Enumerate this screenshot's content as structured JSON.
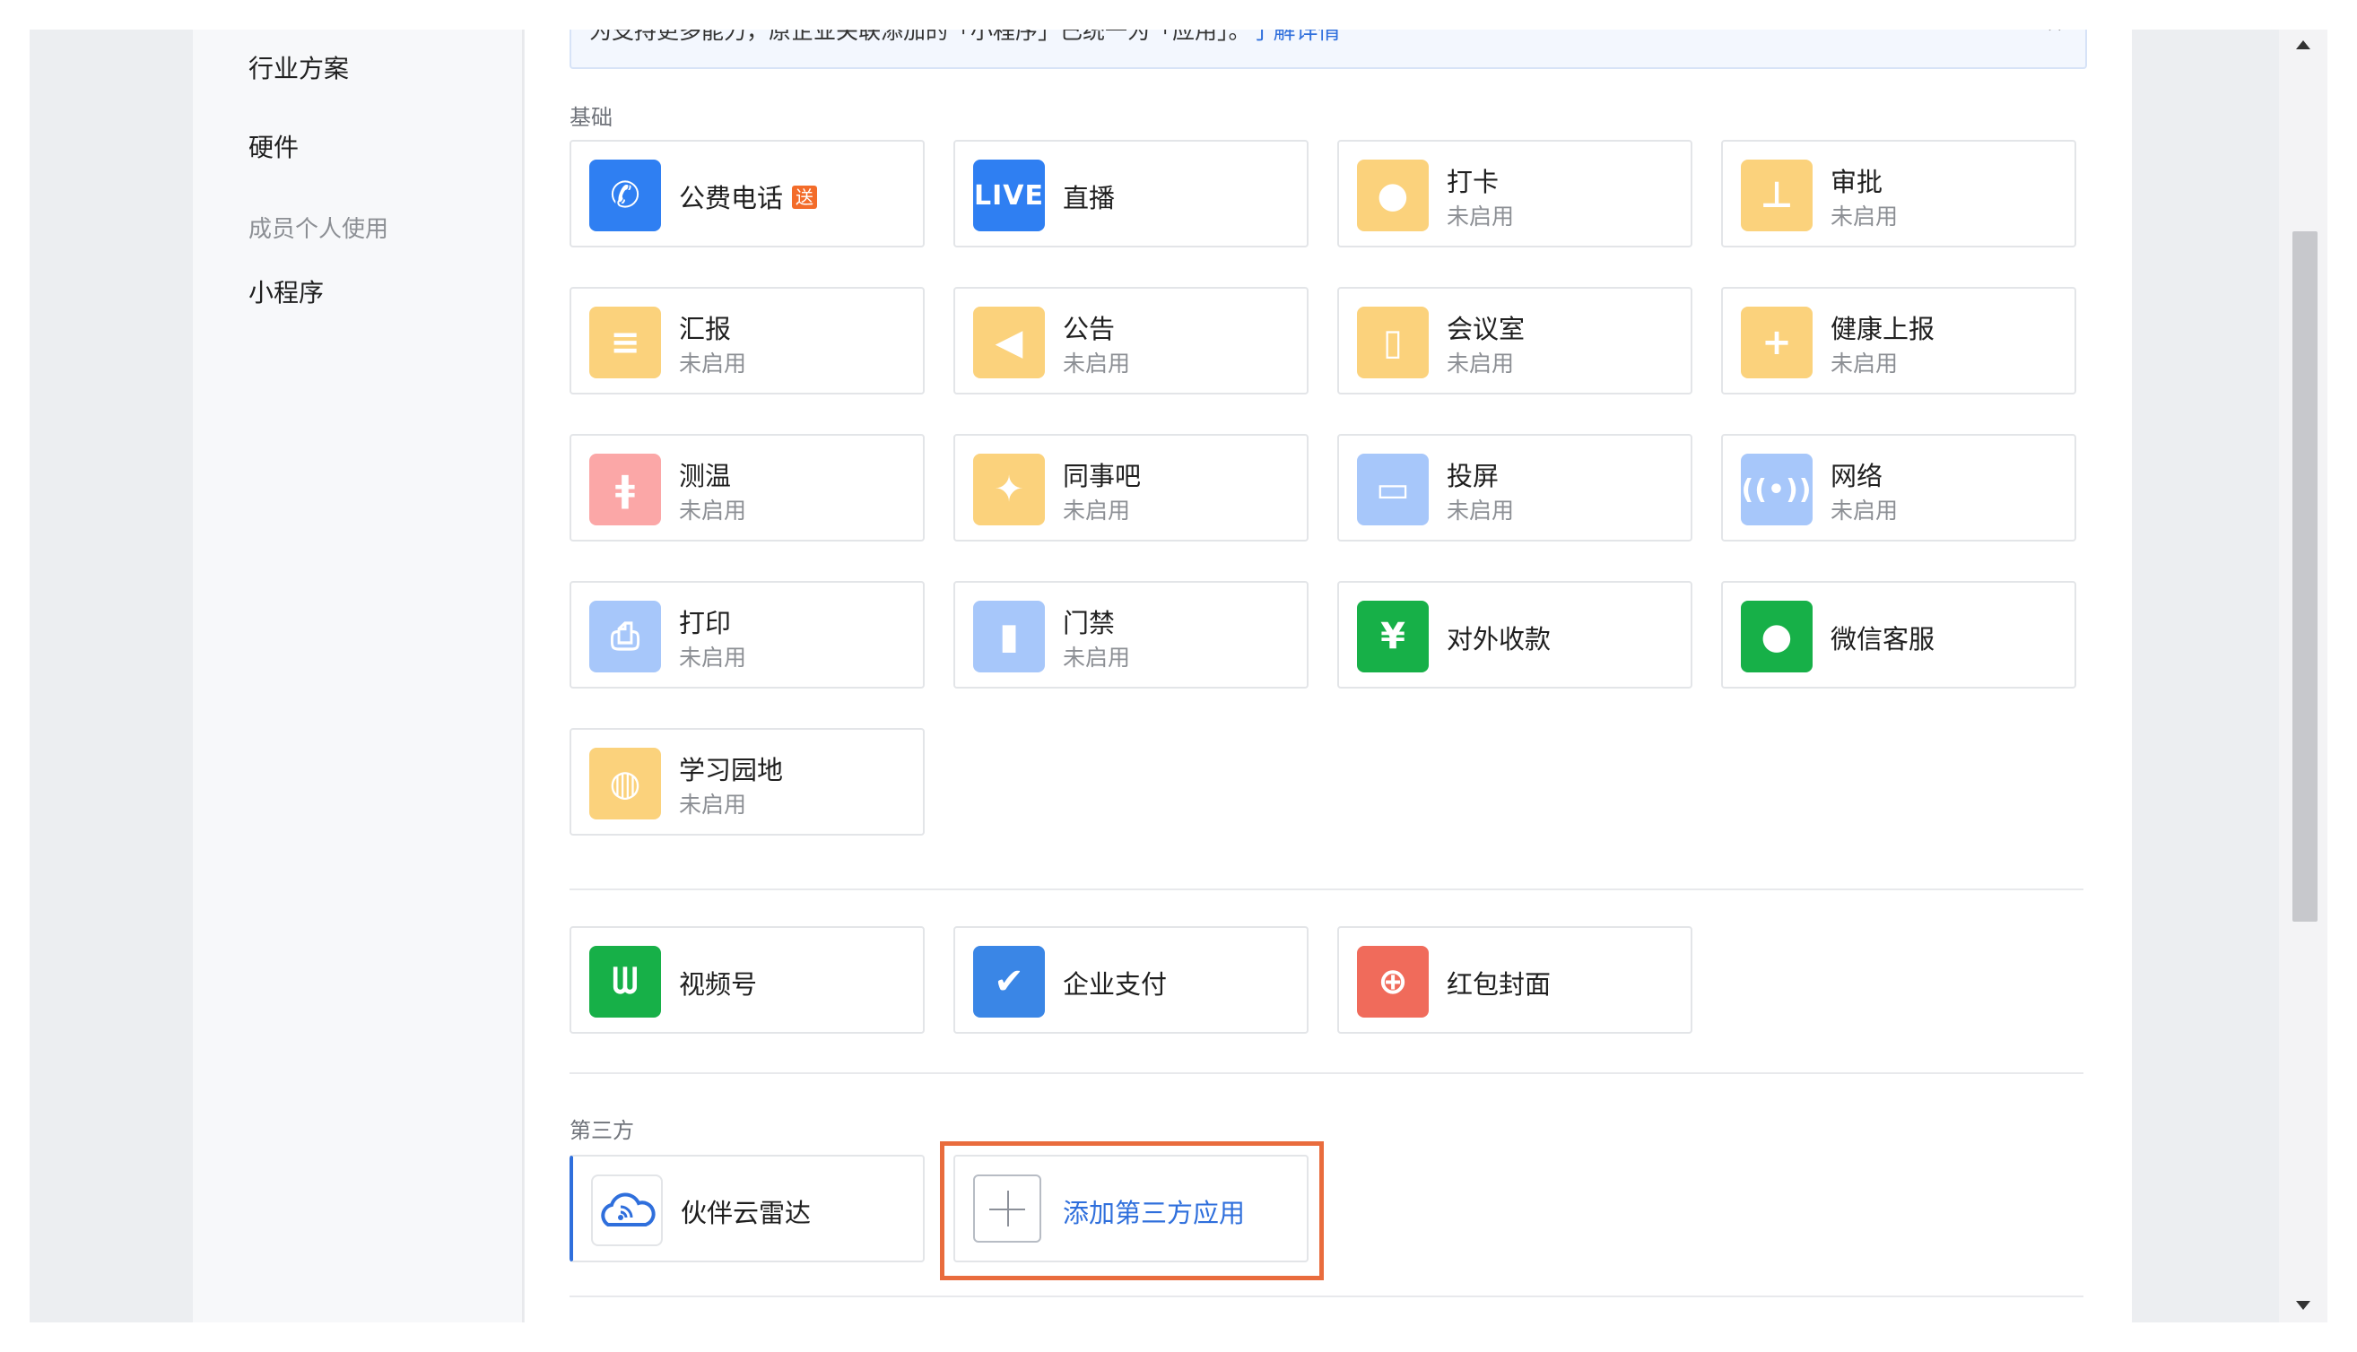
{
  "sidebar": {
    "items": [
      {
        "label": "行业方案"
      },
      {
        "label": "硬件"
      },
      {
        "label": "成员个人使用"
      },
      {
        "label": "小程序"
      }
    ]
  },
  "notice": {
    "text": "为支持更多能力，原企业关联添加的「小程序」已统一为「应用」。",
    "link": "了解详情",
    "close": "×"
  },
  "sections": {
    "basic_label": "基础",
    "third_party_label": "第三方"
  },
  "basic_apps": [
    {
      "name": "公费电话",
      "badge": "送",
      "status": "",
      "icon": "phone-icon",
      "color": "#2f7ff2",
      "glyph": "✆"
    },
    {
      "name": "直播",
      "status": "",
      "icon": "live-icon",
      "color": "#2f7ff2",
      "glyph": "LIVE"
    },
    {
      "name": "打卡",
      "status": "未启用",
      "icon": "location-pin-icon",
      "color": "#fbd27c",
      "glyph": "●"
    },
    {
      "name": "审批",
      "status": "未启用",
      "icon": "stamp-icon",
      "color": "#fbd27c",
      "glyph": "⊥"
    },
    {
      "name": "汇报",
      "status": "未启用",
      "icon": "report-icon",
      "color": "#fbd27c",
      "glyph": "≡"
    },
    {
      "name": "公告",
      "status": "未启用",
      "icon": "megaphone-icon",
      "color": "#fbd27c",
      "glyph": "◀"
    },
    {
      "name": "会议室",
      "status": "未启用",
      "icon": "door-icon",
      "color": "#fbd27c",
      "glyph": "▯"
    },
    {
      "name": "健康上报",
      "status": "未启用",
      "icon": "health-clipboard-icon",
      "color": "#fbd27c",
      "glyph": "+"
    },
    {
      "name": "测温",
      "status": "未启用",
      "icon": "thermometer-icon",
      "color": "#fba7a7",
      "glyph": "ǂ"
    },
    {
      "name": "同事吧",
      "status": "未启用",
      "icon": "community-icon",
      "color": "#fbd27c",
      "glyph": "✦"
    },
    {
      "name": "投屏",
      "status": "未启用",
      "icon": "screen-cast-icon",
      "color": "#a7c7fa",
      "glyph": "▭"
    },
    {
      "name": "网络",
      "status": "未启用",
      "icon": "router-icon",
      "color": "#a7c7fa",
      "glyph": "((•))"
    },
    {
      "name": "打印",
      "status": "未启用",
      "icon": "printer-icon",
      "color": "#a7c7fa",
      "glyph": "⎙"
    },
    {
      "name": "门禁",
      "status": "未启用",
      "icon": "access-door-icon",
      "color": "#a7c7fa",
      "glyph": "▮"
    },
    {
      "name": "对外收款",
      "status": "",
      "icon": "yuan-shield-icon",
      "color": "#17b048",
      "glyph": "¥"
    },
    {
      "name": "微信客服",
      "status": "",
      "icon": "chat-bubble-icon",
      "color": "#17b048",
      "glyph": "●"
    },
    {
      "name": "学习园地",
      "status": "未启用",
      "icon": "planet-icon",
      "color": "#fbd27c",
      "glyph": "◍"
    }
  ],
  "wechat_apps": [
    {
      "name": "视频号",
      "icon": "channels-icon",
      "color": "#17b048",
      "glyph": "ᗯ"
    },
    {
      "name": "企业支付",
      "icon": "payment-icon",
      "color": "#3a86e6",
      "glyph": "✔"
    },
    {
      "name": "红包封面",
      "icon": "red-envelope-icon",
      "color": "#f06b5b",
      "glyph": "⊕"
    }
  ],
  "third_party_apps": [
    {
      "name": "伙伴云雷达",
      "icon": "cloud-radar-icon"
    }
  ],
  "add_third_party": {
    "label": "添加第三方应用"
  }
}
